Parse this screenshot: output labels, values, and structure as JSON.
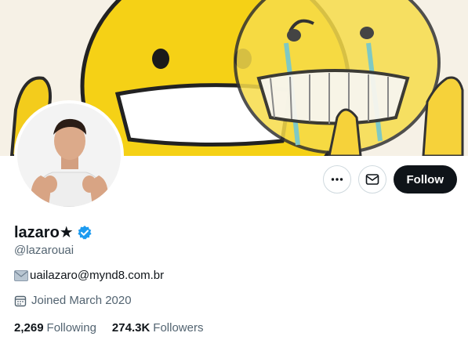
{
  "profile": {
    "display_name": "lazaro★",
    "handle": "@lazarouai",
    "bio_text": "uailazaro@mynd8.com.br",
    "joined": "Joined March 2020"
  },
  "stats": {
    "following_count": "2,269",
    "following_label": "Following",
    "followers_count": "274.3K",
    "followers_label": "Followers"
  },
  "actions": {
    "follow_label": "Follow",
    "more_icon": "more-horizontal-icon",
    "message_icon": "envelope-icon"
  },
  "icons": {
    "verified": "verified-badge-icon",
    "bio_emoji": "envelope-emoji-icon",
    "calendar": "calendar-icon"
  },
  "colors": {
    "follow_bg": "#0f1419",
    "verified_blue": "#1d9bf0",
    "secondary_text": "#536471"
  }
}
